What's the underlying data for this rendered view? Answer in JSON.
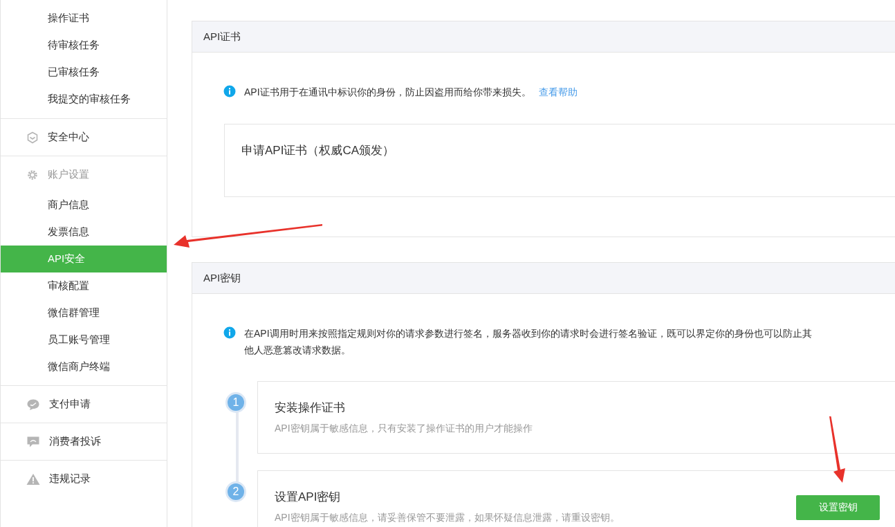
{
  "sidebar": {
    "sections": [
      {
        "items": [
          {
            "label": "操作证书",
            "selected": false
          },
          {
            "label": "待审核任务",
            "selected": false
          },
          {
            "label": "已审核任务",
            "selected": false
          },
          {
            "label": "我提交的审核任务",
            "selected": false
          }
        ]
      },
      {
        "header": {
          "label": "安全中心",
          "muted": false
        }
      },
      {
        "header": {
          "label": "账户设置",
          "muted": true
        },
        "items": [
          {
            "label": "商户信息",
            "selected": false
          },
          {
            "label": "发票信息",
            "selected": false
          },
          {
            "label": "API安全",
            "selected": true
          },
          {
            "label": "审核配置",
            "selected": false
          },
          {
            "label": "微信群管理",
            "selected": false
          },
          {
            "label": "员工账号管理",
            "selected": false
          },
          {
            "label": "微信商户终端",
            "selected": false
          }
        ]
      },
      {
        "header": {
          "label": "支付申请",
          "muted": false
        }
      },
      {
        "header": {
          "label": "消费者投诉",
          "muted": false
        }
      },
      {
        "header": {
          "label": "违规记录",
          "muted": false
        }
      }
    ]
  },
  "panels": [
    {
      "title": "API证书",
      "info": {
        "lines": [
          "API证书用于在通讯中标识你的身份，防止因盗用而给你带来损失。"
        ],
        "link": "查看帮助"
      },
      "card": {
        "title": "申请API证书（权威CA颁发）"
      }
    },
    {
      "title": "API密钥",
      "info": {
        "lines": [
          "在API调用时用来按照指定规则对你的请求参数进行签名，服务器收到你的请求时会进行签名验证，既可以界定你的身份也可以防止其",
          "他人恶意篡改请求数据。"
        ]
      },
      "steps": [
        {
          "number": "1",
          "title": "安装操作证书",
          "description": "API密钥属于敏感信息，只有安装了操作证书的用户才能操作"
        },
        {
          "number": "2",
          "title": "设置API密钥",
          "description": "API密钥属于敏感信息，请妥善保管不要泄露，如果怀疑信息泄露，请重设密钥。",
          "button": "设置密钥"
        }
      ]
    }
  ]
}
